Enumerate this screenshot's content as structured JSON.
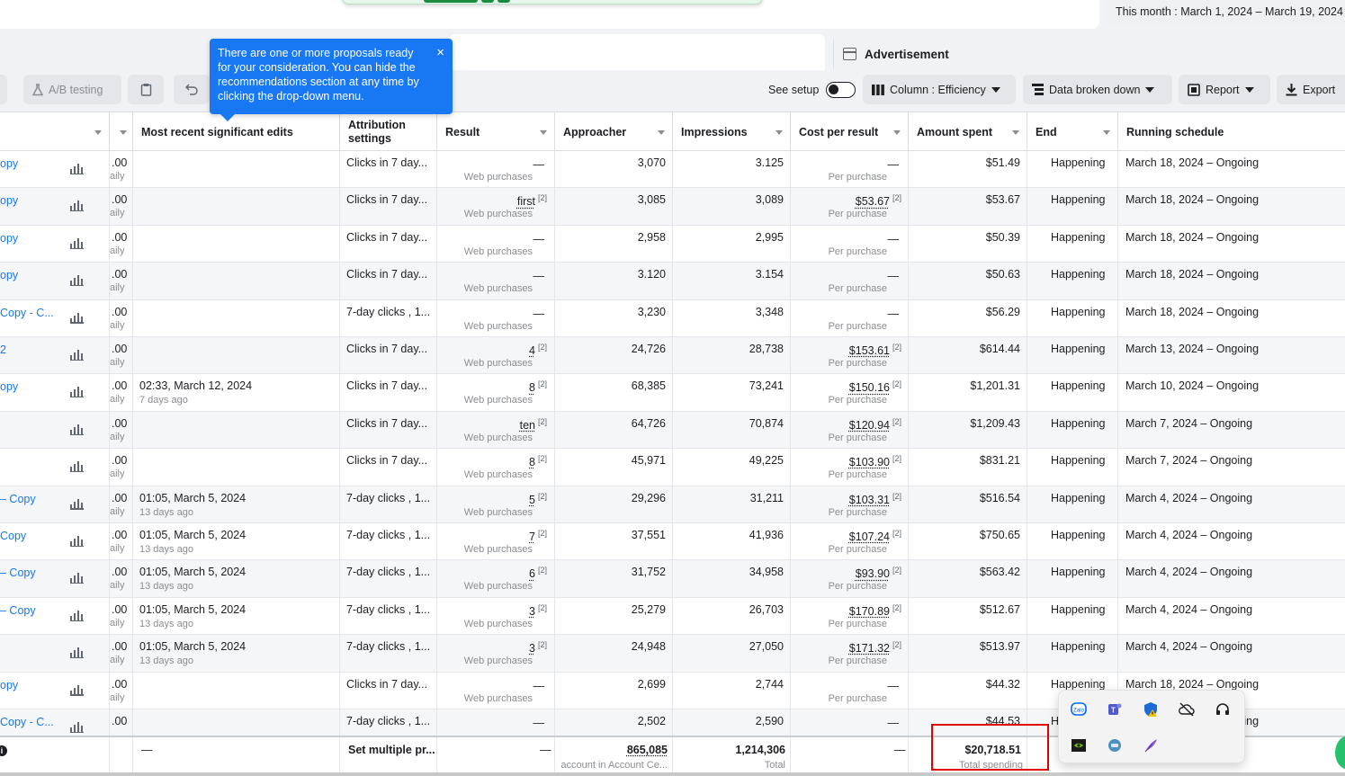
{
  "top": {
    "date_range": "This month : March 1, 2024 – March 19, 2024"
  },
  "ad_panel": {
    "title": "Advertisement"
  },
  "toolbar": {
    "ab_testing": "A/B testing",
    "see_setup": "See setup",
    "column": "Column : Efficiency",
    "data_broken_down": "Data broken down",
    "report": "Report",
    "export": "Export"
  },
  "tooltip": {
    "text": "There are one or more proposals ready for your consideration. You can hide the recommendations section at any time by clicking the drop-down menu.",
    "close": "×"
  },
  "columns": {
    "recent_edits": "Most recent significant edits",
    "attribution": "Attribution settings",
    "result": "Result",
    "reach": "Approacher",
    "impressions": "Impressions",
    "cpr": "Cost per result",
    "spent": "Amount spent",
    "end": "End",
    "schedule": "Running schedule"
  },
  "rows": [
    {
      "name": "opy",
      "budget": ".00",
      "budget_sub": "aily",
      "edit": "",
      "edit_sub": "",
      "attr": "Clicks in 7 day...",
      "result": "—",
      "result_sup": "",
      "result_sub": "Web purchases",
      "reach": "3,070",
      "imp": "3.125",
      "cpr": "—",
      "cpr_sup": "",
      "cpr_sub": "Per purchase",
      "spent": "$51.49",
      "end": "Happening",
      "sched": "March 18, 2024 – Ongoing"
    },
    {
      "name": "opy",
      "budget": ".00",
      "budget_sub": "aily",
      "edit": "",
      "edit_sub": "",
      "attr": "Clicks in 7 day...",
      "result": "first",
      "result_sup": "[2]",
      "result_sub": "Web purchases",
      "reach": "3,085",
      "imp": "3,089",
      "cpr": "$53.67",
      "cpr_sup": "[2]",
      "cpr_sub": "Per purchase",
      "spent": "$53.67",
      "end": "Happening",
      "sched": "March 18, 2024 – Ongoing"
    },
    {
      "name": "opy",
      "budget": ".00",
      "budget_sub": "aily",
      "edit": "",
      "edit_sub": "",
      "attr": "Clicks in 7 day...",
      "result": "—",
      "result_sup": "",
      "result_sub": "Web purchases",
      "reach": "2,958",
      "imp": "2,995",
      "cpr": "—",
      "cpr_sup": "",
      "cpr_sub": "Per purchase",
      "spent": "$50.39",
      "end": "Happening",
      "sched": "March 18, 2024 – Ongoing"
    },
    {
      "name": "opy",
      "budget": ".00",
      "budget_sub": "aily",
      "edit": "",
      "edit_sub": "",
      "attr": "Clicks in 7 day...",
      "result": "—",
      "result_sup": "",
      "result_sub": "Web purchases",
      "reach": "3.120",
      "imp": "3.154",
      "cpr": "—",
      "cpr_sup": "",
      "cpr_sub": "Per purchase",
      "spent": "$50.63",
      "end": "Happening",
      "sched": "March 18, 2024 – Ongoing"
    },
    {
      "name": "Copy - C...",
      "budget": ".00",
      "budget_sub": "aily",
      "edit": "",
      "edit_sub": "",
      "attr": "7-day clicks , 1...",
      "result": "—",
      "result_sup": "",
      "result_sub": "Web purchases",
      "reach": "3,230",
      "imp": "3,348",
      "cpr": "—",
      "cpr_sup": "",
      "cpr_sub": "Per purchase",
      "spent": "$56.29",
      "end": "Happening",
      "sched": "March 18, 2024 – Ongoing"
    },
    {
      "name": "2",
      "budget": ".00",
      "budget_sub": "aily",
      "edit": "",
      "edit_sub": "",
      "attr": "Clicks in 7 day...",
      "result": "4",
      "result_sup": "[2]",
      "result_sub": "Web purchases",
      "reach": "24,726",
      "imp": "28,738",
      "cpr": "$153.61",
      "cpr_sup": "[2]",
      "cpr_sub": "Per purchase",
      "spent": "$614.44",
      "end": "Happening",
      "sched": "March 13, 2024 – Ongoing"
    },
    {
      "name": "opy",
      "budget": ".00",
      "budget_sub": "aily",
      "edit": "02:33, March 12, 2024",
      "edit_sub": "7 days ago",
      "attr": "Clicks in 7 day...",
      "result": "8",
      "result_sup": "[2]",
      "result_sub": "Web purchases",
      "reach": "68,385",
      "imp": "73,241",
      "cpr": "$150.16",
      "cpr_sup": "[2]",
      "cpr_sub": "Per purchase",
      "spent": "$1,201.31",
      "end": "Happening",
      "sched": "March 10, 2024 – Ongoing"
    },
    {
      "name": "",
      "budget": ".00",
      "budget_sub": "aily",
      "edit": "",
      "edit_sub": "",
      "attr": "Clicks in 7 day...",
      "result": "ten",
      "result_sup": "[2]",
      "result_sub": "Web purchases",
      "reach": "64,726",
      "imp": "70,874",
      "cpr": "$120.94",
      "cpr_sup": "[2]",
      "cpr_sub": "Per purchase",
      "spent": "$1,209.43",
      "end": "Happening",
      "sched": "March 7, 2024 – Ongoing"
    },
    {
      "name": "",
      "budget": ".00",
      "budget_sub": "aily",
      "edit": "",
      "edit_sub": "",
      "attr": "Clicks in 7 day...",
      "result": "8",
      "result_sup": "[2]",
      "result_sub": "Web purchases",
      "reach": "45,971",
      "imp": "49,225",
      "cpr": "$103.90",
      "cpr_sup": "[2]",
      "cpr_sub": "Per purchase",
      "spent": "$831.21",
      "end": "Happening",
      "sched": "March 7, 2024 – Ongoing"
    },
    {
      "name": "– Copy",
      "budget": ".00",
      "budget_sub": "aily",
      "edit": "01:05, March 5, 2024",
      "edit_sub": "13 days ago",
      "attr": "7-day clicks , 1...",
      "result": "5",
      "result_sup": "[2]",
      "result_sub": "Web purchases",
      "reach": "29,296",
      "imp": "31,211",
      "cpr": "$103.31",
      "cpr_sup": "[2]",
      "cpr_sub": "Per purchase",
      "spent": "$516.54",
      "end": "Happening",
      "sched": "March 4, 2024 – Ongoing"
    },
    {
      "name": "Copy",
      "budget": ".00",
      "budget_sub": "aily",
      "edit": "01:05, March 5, 2024",
      "edit_sub": "13 days ago",
      "attr": "7-day clicks , 1...",
      "result": "7",
      "result_sup": "[2]",
      "result_sub": "Web purchases",
      "reach": "37,551",
      "imp": "41,936",
      "cpr": "$107.24",
      "cpr_sup": "[2]",
      "cpr_sub": "Per purchase",
      "spent": "$750.65",
      "end": "Happening",
      "sched": "March 4, 2024 – Ongoing"
    },
    {
      "name": "– Copy",
      "budget": ".00",
      "budget_sub": "aily",
      "edit": "01:05, March 5, 2024",
      "edit_sub": "13 days ago",
      "attr": "7-day clicks , 1...",
      "result": "6",
      "result_sup": "[2]",
      "result_sub": "Web purchases",
      "reach": "31,752",
      "imp": "34,958",
      "cpr": "$93.90",
      "cpr_sup": "[2]",
      "cpr_sub": "Per purchase",
      "spent": "$563.42",
      "end": "Happening",
      "sched": "March 4, 2024 – Ongoing"
    },
    {
      "name": "– Copy",
      "budget": ".00",
      "budget_sub": "aily",
      "edit": "01:05, March 5, 2024",
      "edit_sub": "13 days ago",
      "attr": "7-day clicks , 1...",
      "result": "3",
      "result_sup": "[2]",
      "result_sub": "Web purchases",
      "reach": "25,279",
      "imp": "26,703",
      "cpr": "$170.89",
      "cpr_sup": "[2]",
      "cpr_sub": "Per purchase",
      "spent": "$512.67",
      "end": "Happening",
      "sched": "March 4, 2024 – Ongoing"
    },
    {
      "name": "",
      "budget": ".00",
      "budget_sub": "aily",
      "edit": "01:05, March 5, 2024",
      "edit_sub": "13 days ago",
      "attr": "7-day clicks , 1...",
      "result": "3",
      "result_sup": "[2]",
      "result_sub": "Web purchases",
      "reach": "24,948",
      "imp": "27,050",
      "cpr": "$171.32",
      "cpr_sup": "[2]",
      "cpr_sub": "Per purchase",
      "spent": "$513.97",
      "end": "Happening",
      "sched": "March 4, 2024 – Ongoing"
    },
    {
      "name": "opy",
      "budget": ".00",
      "budget_sub": "aily",
      "edit": "",
      "edit_sub": "",
      "attr": "Clicks in 7 day...",
      "result": "—",
      "result_sup": "",
      "result_sub": "Web purchases",
      "reach": "2,699",
      "imp": "2,744",
      "cpr": "—",
      "cpr_sup": "",
      "cpr_sub": "Per purchase",
      "spent": "$44.32",
      "end": "Happening",
      "sched": "March 18, 2024 – Ongoing"
    },
    {
      "name": "Copy - C...",
      "budget": ".00",
      "budget_sub": "",
      "edit": "",
      "edit_sub": "",
      "attr": "7-day clicks , 1...",
      "result": "—",
      "result_sup": "",
      "result_sub": "",
      "reach": "2,502",
      "imp": "2,590",
      "cpr": "—",
      "cpr_sup": "",
      "cpr_sub": "",
      "spent": "$44.53",
      "end": "Happening",
      "sched": "March 18, 2024 – Ongoing"
    }
  ],
  "totals": {
    "edits": "—",
    "attribution": "Set multiple pr...",
    "result": "—",
    "reach": "865,085",
    "reach_sub": "account in Account Ce...",
    "impressions": "1,214,306",
    "impressions_sub": "Total",
    "cpr": "—",
    "spent": "$20,718.51",
    "spent_sub": "Total spending"
  },
  "colors": {
    "accent": "#1877f2",
    "highlight": "#e00000"
  },
  "tray_icons": [
    "zalo-icon",
    "teams-icon",
    "defender-warning-icon",
    "cloud-offline-icon",
    "headset-icon",
    "nvidia-icon",
    "chat-app-icon",
    "feather-icon"
  ]
}
